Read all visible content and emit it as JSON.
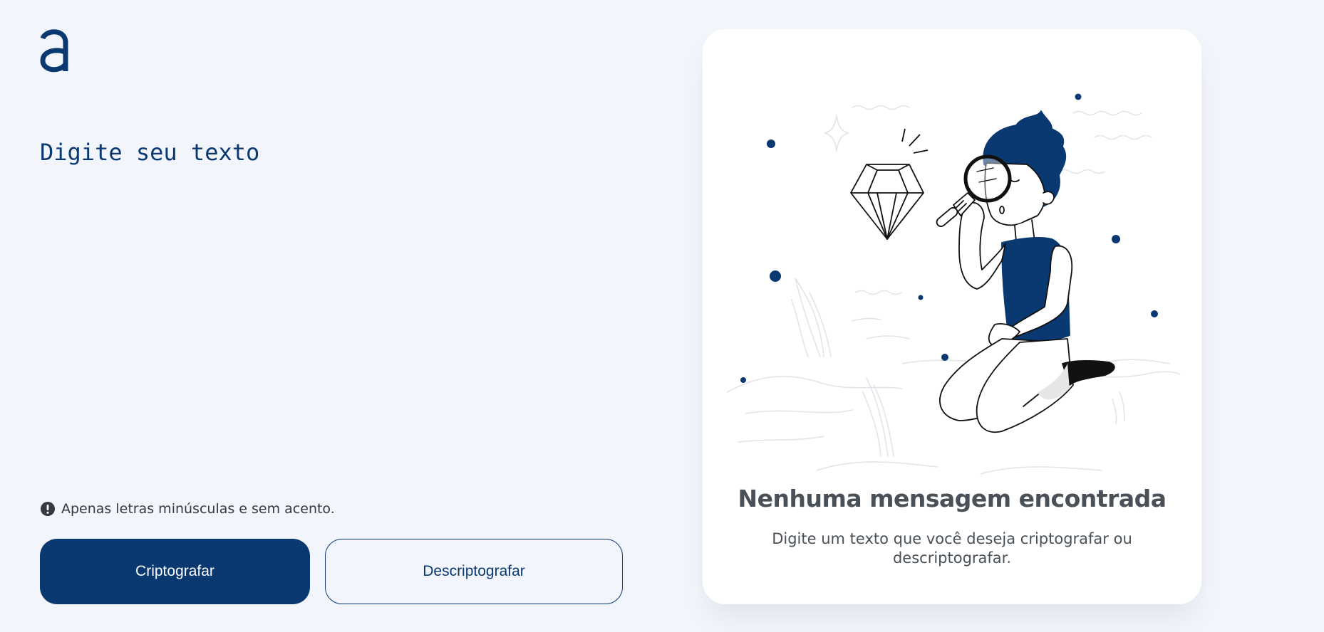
{
  "logo": {
    "icon": "logo-a-icon",
    "color": "#0a3871"
  },
  "input": {
    "placeholder": "Digite seu texto",
    "value": ""
  },
  "hint": {
    "icon": "exclamation-circle-icon",
    "text": "Apenas letras minúsculas e sem acento."
  },
  "buttons": {
    "encrypt_label": "Criptografar",
    "decrypt_label": "Descriptografar"
  },
  "output": {
    "illustration": "person-with-magnifier-looking-at-diamond",
    "title": "Nenhuma mensagem encontrada",
    "text": "Digite um texto que você deseja criptografar ou descriptografar."
  },
  "colors": {
    "background": "#f3f5fc",
    "accent": "#0a3871",
    "card": "#ffffff",
    "text_gray": "#495057"
  }
}
